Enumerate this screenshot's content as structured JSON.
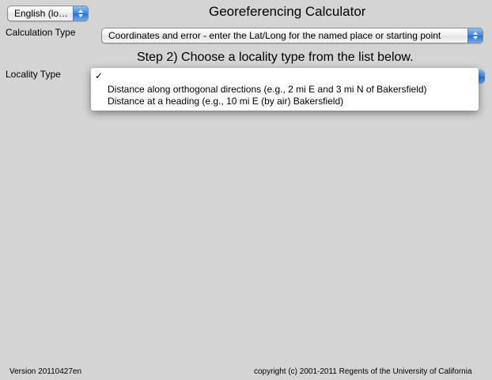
{
  "language_select": {
    "value": "English (lo…"
  },
  "header": {
    "title": "Georeferencing Calculator"
  },
  "calculation_type": {
    "label": "Calculation Type",
    "value": "Coordinates and error - enter the Lat/Long for the named place or starting point"
  },
  "step2": {
    "text": "Step 2) Choose a locality type from the list below."
  },
  "locality_type": {
    "label": "Locality Type",
    "checkmark": "✓",
    "options": [
      "Distance along orthogonal directions (e.g., 2 mi E and 3 mi N of Bakersfield)",
      "Distance at a heading (e.g., 10 mi E (by air) Bakersfield)"
    ]
  },
  "footer": {
    "version": "Version 20110427en",
    "copyright": "copyright (c) 2001-2011 Regents of the University of California"
  },
  "colors": {
    "background": "#d4d4d4",
    "popup_arrow_blue": "#3b86e3"
  },
  "icons": {
    "popup_arrows": "up-down-arrows-icon",
    "check": "checkmark-icon"
  }
}
